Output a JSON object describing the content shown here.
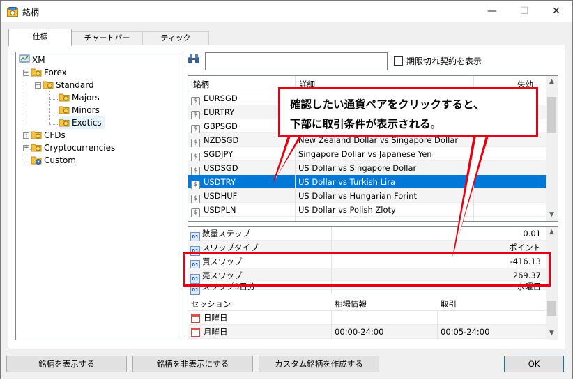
{
  "window": {
    "title": "銘柄",
    "minimize": "—",
    "maximize": "☐",
    "close": "✕"
  },
  "tabs": [
    "仕様",
    "チャートバー",
    "ティック"
  ],
  "tree": {
    "root": "XM",
    "forex": "Forex",
    "standard": "Standard",
    "majors": "Majors",
    "minors": "Minors",
    "exotics": "Exotics",
    "cfds": "CFDs",
    "crypto": "Cryptocurrencies",
    "custom": "Custom"
  },
  "search": {
    "value": "",
    "checkbox_label": "期限切れ契約を表示"
  },
  "symbols": {
    "headers": {
      "symbol": "銘柄",
      "detail": "詳細",
      "expiry": "失効"
    },
    "rows": [
      {
        "symbol": "EURSGD",
        "detail": ""
      },
      {
        "symbol": "EURTRY",
        "detail": ""
      },
      {
        "symbol": "GBPSGD",
        "detail": ""
      },
      {
        "symbol": "NZDSGD",
        "detail": "New Zealand Dollar vs Singapore Dollar"
      },
      {
        "symbol": "SGDJPY",
        "detail": "Singapore Dollar vs Japanese Yen"
      },
      {
        "symbol": "USDSGD",
        "detail": "US Dollar vs Singapore Dollar"
      },
      {
        "symbol": "USDTRY",
        "detail": "US Dollar vs Turkish Lira"
      },
      {
        "symbol": "USDHUF",
        "detail": "US Dollar vs Hungarian Forint"
      },
      {
        "symbol": "USDPLN",
        "detail": "US Dollar vs Polish Zloty"
      }
    ],
    "selected": "USDTRY"
  },
  "properties": [
    {
      "name": "数量ステップ",
      "value": "0.01"
    },
    {
      "name": "スワップタイプ",
      "value": "ポイント"
    },
    {
      "name": "買スワップ",
      "value": "-416.13"
    },
    {
      "name": "売スワップ",
      "value": "269.37"
    },
    {
      "name": "スワップ3日分",
      "value": "水曜日"
    }
  ],
  "sessions": {
    "headers": {
      "session": "セッション",
      "quote": "相場情報",
      "trade": "取引"
    },
    "rows": [
      {
        "day": "日曜日",
        "quote": "",
        "trade": ""
      },
      {
        "day": "月曜日",
        "quote": "00:00-24:00",
        "trade": "00:05-24:00"
      }
    ]
  },
  "buttons": {
    "show": "銘柄を表示する",
    "hide": "銘柄を非表示にする",
    "custom": "カスタム銘柄を作成する",
    "ok": "OK"
  },
  "annotation": {
    "line1": "確認したい通貨ペアをクリックすると、",
    "line2": "下部に取引条件が表示される。",
    "color": "#e60012"
  },
  "colors": {
    "selection": "#0078d7",
    "folder": "#f5c342"
  }
}
